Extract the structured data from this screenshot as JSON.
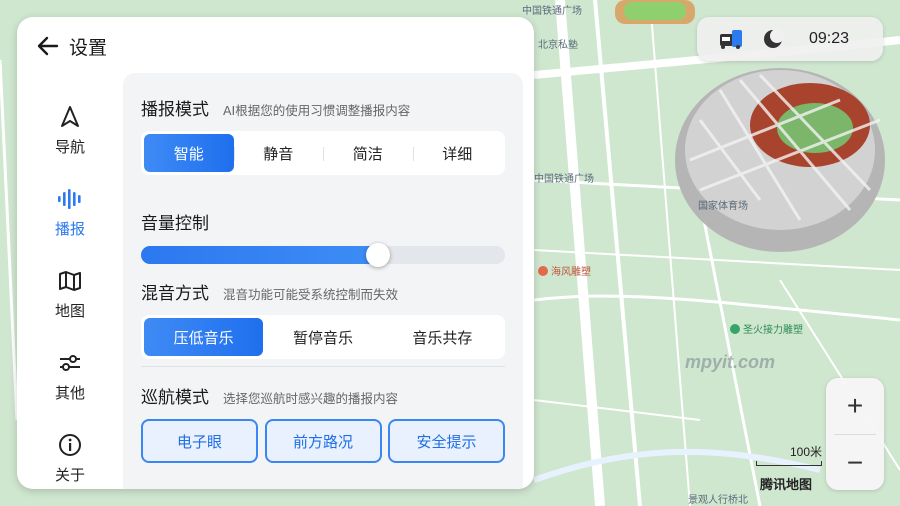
{
  "map": {
    "labels": {
      "metro": "中国铁通广场",
      "sports": "北京私塾",
      "plaza": "中国铁通广场",
      "national_stadium": "国家体育场",
      "sculpture_red": "海风雕塑",
      "torch_sculpture": "圣火接力雕塑",
      "bridge": "景观人行桥北"
    },
    "colors": {
      "land": "#cfe6cf",
      "road": "#ffffff",
      "stadium": "#c9c9c9"
    }
  },
  "status": {
    "car_icon": "car-icon",
    "moon_icon": "moon-icon",
    "time": "09:23"
  },
  "zoom": {
    "in_label": "+",
    "out_label": "−"
  },
  "scale": {
    "value": "100米"
  },
  "brand": "腾讯地图",
  "watermark": "mpyit.com",
  "settings": {
    "title": "设置",
    "back_icon": "back-arrow-icon",
    "accent": "#2c7af0",
    "sidebar": [
      {
        "label": "导航",
        "icon": "navigation-arrow-icon",
        "active": false
      },
      {
        "label": "播报",
        "icon": "audio-wave-icon",
        "active": true
      },
      {
        "label": "地图",
        "icon": "map-icon",
        "active": false
      },
      {
        "label": "其他",
        "icon": "sliders-icon",
        "active": false
      },
      {
        "label": "关于",
        "icon": "info-icon",
        "active": false
      }
    ],
    "broadcast_mode": {
      "title": "播报模式",
      "subtitle": "AI根据您的使用习惯调整播报内容",
      "options": [
        "智能",
        "静音",
        "简洁",
        "详细"
      ],
      "selected": "智能"
    },
    "volume": {
      "title": "音量控制",
      "level": 0.65
    },
    "mix_mode": {
      "title": "混音方式",
      "subtitle": "混音功能可能受系统控制而失效",
      "options": [
        "压低音乐",
        "暂停音乐",
        "音乐共存"
      ],
      "selected": "压低音乐"
    },
    "cruise_mode": {
      "title": "巡航模式",
      "subtitle": "选择您巡航时感兴趣的播报内容",
      "options": [
        "电子眼",
        "前方路况",
        "安全提示"
      ]
    }
  }
}
